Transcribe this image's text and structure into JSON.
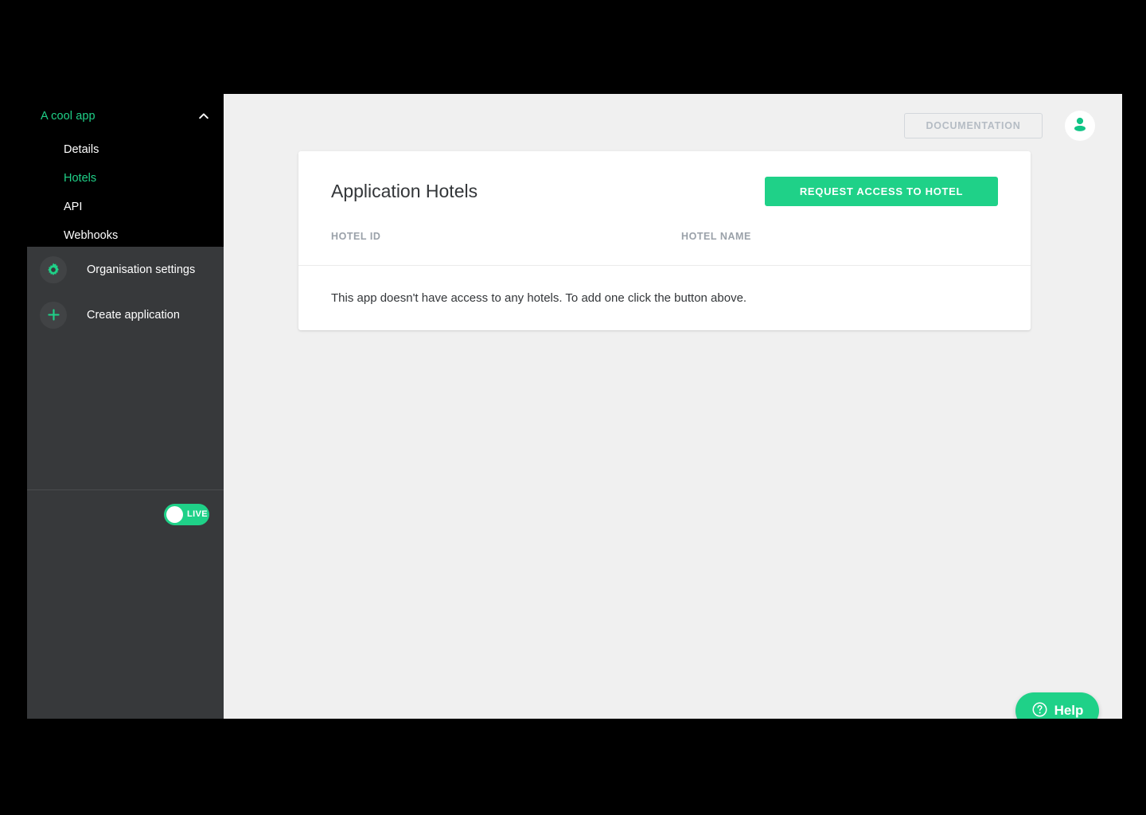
{
  "sidebar": {
    "app": {
      "label": "A cool app",
      "collapse_icon": "chevron-up-icon"
    },
    "nav_items": [
      {
        "label": "Details",
        "active": false
      },
      {
        "label": "Hotels",
        "active": true
      },
      {
        "label": "API",
        "active": false
      },
      {
        "label": "Webhooks",
        "active": false
      }
    ],
    "actions": [
      {
        "label": "Organisation settings",
        "icon": "gear-icon"
      },
      {
        "label": "Create application",
        "icon": "plus-icon"
      }
    ],
    "environment_toggle": {
      "label": "LIVE",
      "state": "on"
    }
  },
  "topbar": {
    "documentation_label": "DOCUMENTATION",
    "avatar_icon": "user-avatar-icon"
  },
  "card": {
    "title": "Application Hotels",
    "primary_action_label": "REQUEST ACCESS TO HOTEL",
    "table": {
      "columns": [
        "HOTEL ID",
        "HOTEL NAME"
      ],
      "rows": [],
      "empty_message": "This app doesn't have access to any hotels. To add one click the button above."
    }
  },
  "help_widget": {
    "label": "Help",
    "icon": "question-circle-icon"
  },
  "colors": {
    "accent_green": "#1fd188",
    "sidebar_dark": "#37393b",
    "sidebar_black": "#000000",
    "page_background": "#f0f0f0",
    "card_background": "#ffffff",
    "muted_text": "#9aa1a9"
  }
}
